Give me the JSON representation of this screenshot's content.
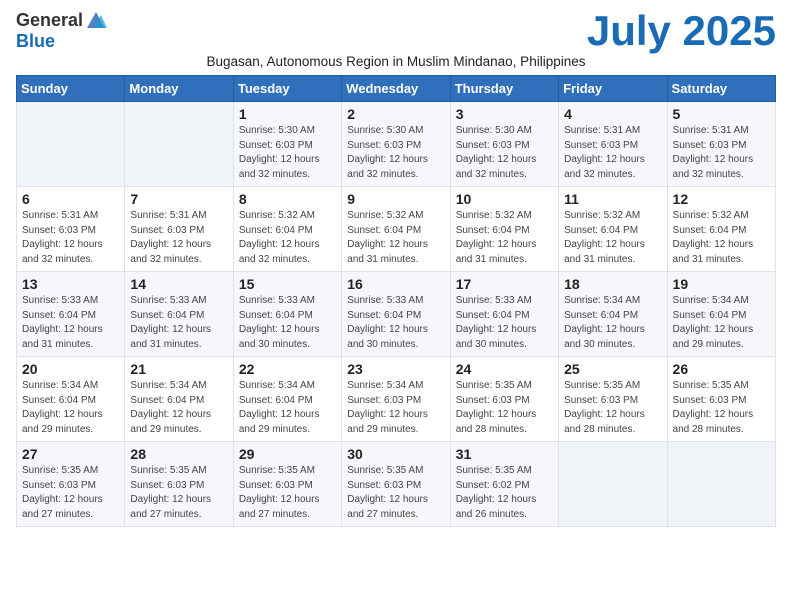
{
  "logo": {
    "general": "General",
    "blue": "Blue"
  },
  "title": "July 2025",
  "subtitle": "Bugasan, Autonomous Region in Muslim Mindanao, Philippines",
  "header": [
    "Sunday",
    "Monday",
    "Tuesday",
    "Wednesday",
    "Thursday",
    "Friday",
    "Saturday"
  ],
  "weeks": [
    [
      {
        "day": "",
        "info": "",
        "empty": true
      },
      {
        "day": "",
        "info": "",
        "empty": true
      },
      {
        "day": "1",
        "info": "Sunrise: 5:30 AM\nSunset: 6:03 PM\nDaylight: 12 hours\nand 32 minutes."
      },
      {
        "day": "2",
        "info": "Sunrise: 5:30 AM\nSunset: 6:03 PM\nDaylight: 12 hours\nand 32 minutes."
      },
      {
        "day": "3",
        "info": "Sunrise: 5:30 AM\nSunset: 6:03 PM\nDaylight: 12 hours\nand 32 minutes."
      },
      {
        "day": "4",
        "info": "Sunrise: 5:31 AM\nSunset: 6:03 PM\nDaylight: 12 hours\nand 32 minutes."
      },
      {
        "day": "5",
        "info": "Sunrise: 5:31 AM\nSunset: 6:03 PM\nDaylight: 12 hours\nand 32 minutes."
      }
    ],
    [
      {
        "day": "6",
        "info": "Sunrise: 5:31 AM\nSunset: 6:03 PM\nDaylight: 12 hours\nand 32 minutes."
      },
      {
        "day": "7",
        "info": "Sunrise: 5:31 AM\nSunset: 6:03 PM\nDaylight: 12 hours\nand 32 minutes."
      },
      {
        "day": "8",
        "info": "Sunrise: 5:32 AM\nSunset: 6:04 PM\nDaylight: 12 hours\nand 32 minutes."
      },
      {
        "day": "9",
        "info": "Sunrise: 5:32 AM\nSunset: 6:04 PM\nDaylight: 12 hours\nand 31 minutes."
      },
      {
        "day": "10",
        "info": "Sunrise: 5:32 AM\nSunset: 6:04 PM\nDaylight: 12 hours\nand 31 minutes."
      },
      {
        "day": "11",
        "info": "Sunrise: 5:32 AM\nSunset: 6:04 PM\nDaylight: 12 hours\nand 31 minutes."
      },
      {
        "day": "12",
        "info": "Sunrise: 5:32 AM\nSunset: 6:04 PM\nDaylight: 12 hours\nand 31 minutes."
      }
    ],
    [
      {
        "day": "13",
        "info": "Sunrise: 5:33 AM\nSunset: 6:04 PM\nDaylight: 12 hours\nand 31 minutes."
      },
      {
        "day": "14",
        "info": "Sunrise: 5:33 AM\nSunset: 6:04 PM\nDaylight: 12 hours\nand 31 minutes."
      },
      {
        "day": "15",
        "info": "Sunrise: 5:33 AM\nSunset: 6:04 PM\nDaylight: 12 hours\nand 30 minutes."
      },
      {
        "day": "16",
        "info": "Sunrise: 5:33 AM\nSunset: 6:04 PM\nDaylight: 12 hours\nand 30 minutes."
      },
      {
        "day": "17",
        "info": "Sunrise: 5:33 AM\nSunset: 6:04 PM\nDaylight: 12 hours\nand 30 minutes."
      },
      {
        "day": "18",
        "info": "Sunrise: 5:34 AM\nSunset: 6:04 PM\nDaylight: 12 hours\nand 30 minutes."
      },
      {
        "day": "19",
        "info": "Sunrise: 5:34 AM\nSunset: 6:04 PM\nDaylight: 12 hours\nand 29 minutes."
      }
    ],
    [
      {
        "day": "20",
        "info": "Sunrise: 5:34 AM\nSunset: 6:04 PM\nDaylight: 12 hours\nand 29 minutes."
      },
      {
        "day": "21",
        "info": "Sunrise: 5:34 AM\nSunset: 6:04 PM\nDaylight: 12 hours\nand 29 minutes."
      },
      {
        "day": "22",
        "info": "Sunrise: 5:34 AM\nSunset: 6:04 PM\nDaylight: 12 hours\nand 29 minutes."
      },
      {
        "day": "23",
        "info": "Sunrise: 5:34 AM\nSunset: 6:03 PM\nDaylight: 12 hours\nand 29 minutes."
      },
      {
        "day": "24",
        "info": "Sunrise: 5:35 AM\nSunset: 6:03 PM\nDaylight: 12 hours\nand 28 minutes."
      },
      {
        "day": "25",
        "info": "Sunrise: 5:35 AM\nSunset: 6:03 PM\nDaylight: 12 hours\nand 28 minutes."
      },
      {
        "day": "26",
        "info": "Sunrise: 5:35 AM\nSunset: 6:03 PM\nDaylight: 12 hours\nand 28 minutes."
      }
    ],
    [
      {
        "day": "27",
        "info": "Sunrise: 5:35 AM\nSunset: 6:03 PM\nDaylight: 12 hours\nand 27 minutes."
      },
      {
        "day": "28",
        "info": "Sunrise: 5:35 AM\nSunset: 6:03 PM\nDaylight: 12 hours\nand 27 minutes."
      },
      {
        "day": "29",
        "info": "Sunrise: 5:35 AM\nSunset: 6:03 PM\nDaylight: 12 hours\nand 27 minutes."
      },
      {
        "day": "30",
        "info": "Sunrise: 5:35 AM\nSunset: 6:03 PM\nDaylight: 12 hours\nand 27 minutes."
      },
      {
        "day": "31",
        "info": "Sunrise: 5:35 AM\nSunset: 6:02 PM\nDaylight: 12 hours\nand 26 minutes."
      },
      {
        "day": "",
        "info": "",
        "empty": true
      },
      {
        "day": "",
        "info": "",
        "empty": true
      }
    ]
  ]
}
